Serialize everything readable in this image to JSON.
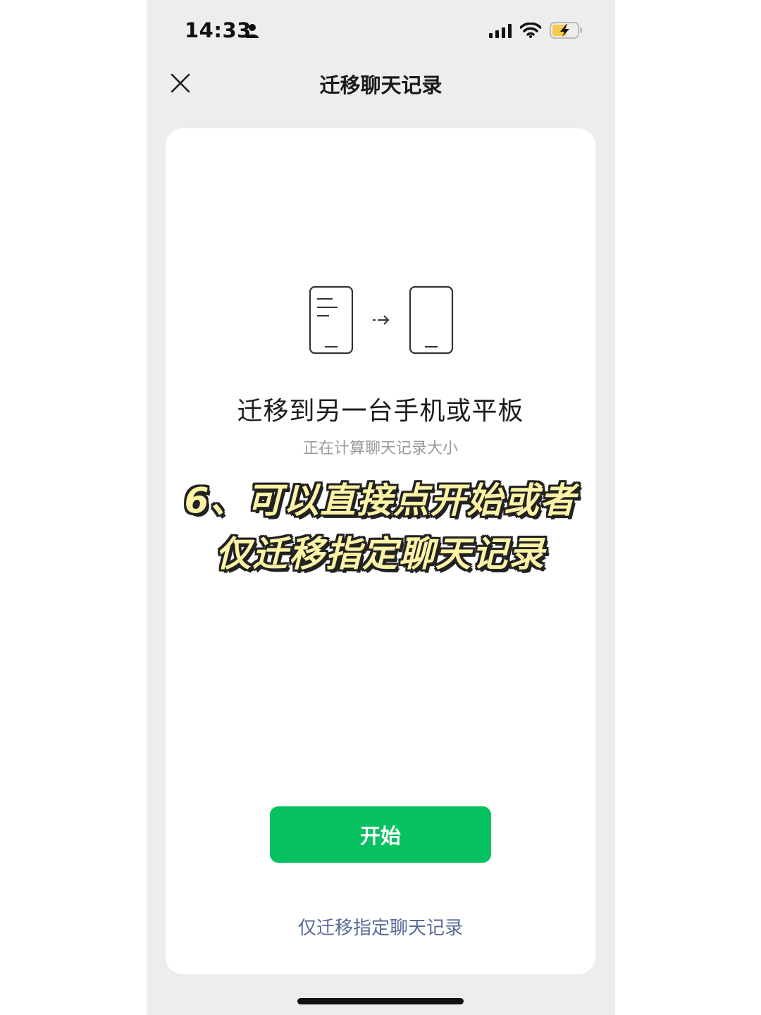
{
  "status_bar": {
    "time": "14:33",
    "icons": [
      "person-icon",
      "signal-icon",
      "wifi-icon",
      "battery-charging-icon"
    ]
  },
  "nav": {
    "title": "迁移聊天记录",
    "close_icon": "close-icon"
  },
  "card": {
    "title": "迁移到另一台手机或平板",
    "subtitle": "正在计算聊天记录大小",
    "illustration": [
      "phone-with-text-icon",
      "arrow-right-icon",
      "phone-blank-icon"
    ]
  },
  "overlay": {
    "line1": "6、可以直接点开始或者",
    "line2": "仅迁移指定聊天记录"
  },
  "actions": {
    "start_label": "开始",
    "selective_label": "仅迁移指定聊天记录"
  },
  "colors": {
    "accent_green": "#07c160",
    "link_blue": "#576b95",
    "background": "#ededed",
    "overlay_text": "#fdf3a6"
  }
}
